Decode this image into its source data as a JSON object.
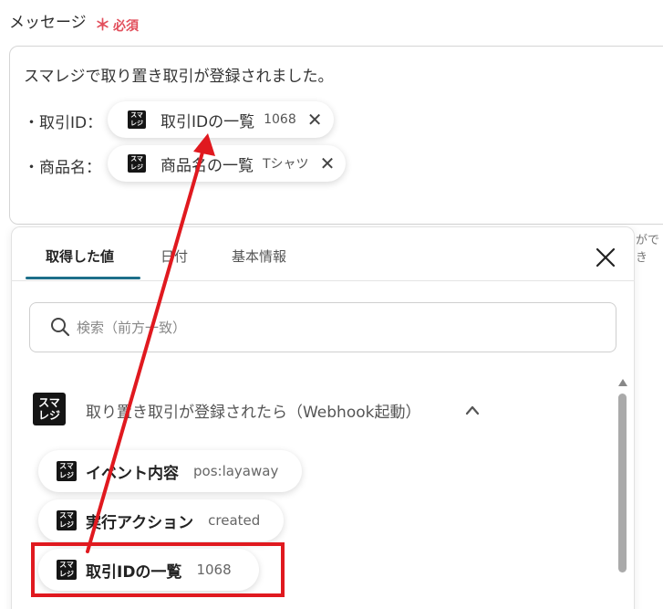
{
  "field": {
    "label": "メッセージ",
    "required_mark": "＊",
    "required_text": "必須"
  },
  "message": {
    "text": "スマレジで取り置き取引が登録されました。",
    "rows": [
      {
        "label": "・取引ID：",
        "chip_name": "取引IDの一覧",
        "chip_value": "1068"
      },
      {
        "label": "・商品名：",
        "chip_name": "商品名の一覧",
        "chip_value": "Tシャツ"
      }
    ],
    "hint_fragment": "ができ"
  },
  "app_logo": {
    "line1": "スマ",
    "line2": "レジ",
    "icon": "smaregi-logo-icon"
  },
  "panel": {
    "tabs": [
      {
        "label": "取得した値",
        "active": true
      },
      {
        "label": "日付",
        "active": false
      },
      {
        "label": "基本情報",
        "active": false
      }
    ],
    "search_placeholder": "検索（前方一致）",
    "group_title": "取り置き取引が登録されたら（Webhook起動）",
    "items": [
      {
        "name": "イベント内容",
        "value": "pos:layaway"
      },
      {
        "name": "実行アクション",
        "value": "created"
      },
      {
        "name": "取引IDの一覧",
        "value": "1068"
      }
    ]
  },
  "colors": {
    "accent": "#1d6f8a",
    "required": "#e24f5c",
    "annotation": "#e0191f"
  }
}
